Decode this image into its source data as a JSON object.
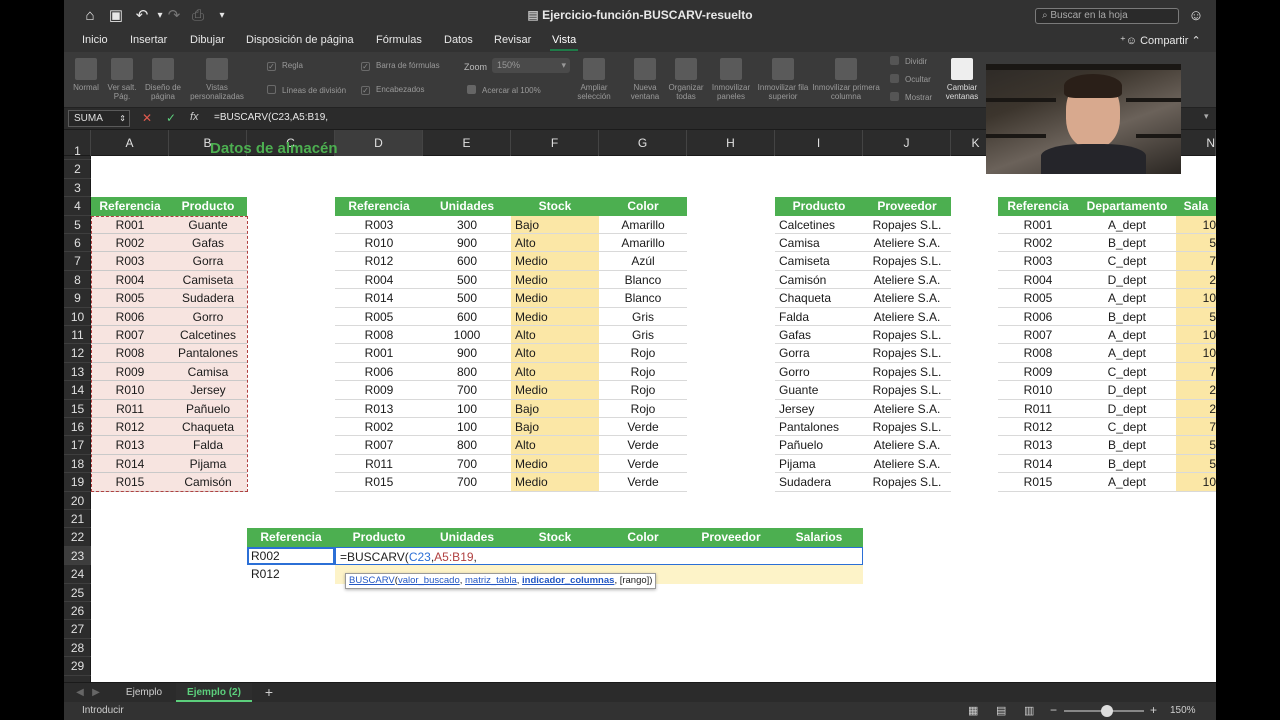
{
  "window": {
    "title": "Ejercicio-función-BUSCARV-resuelto",
    "search_placeholder": "Buscar en la hoja",
    "share_label": "Compartir"
  },
  "ribbon_tabs": [
    "Inicio",
    "Insertar",
    "Dibujar",
    "Disposición de página",
    "Fórmulas",
    "Datos",
    "Revisar",
    "Vista"
  ],
  "active_tab": "Vista",
  "ribbon": {
    "views": [
      "Normal",
      "Ver salt. Pág.",
      "Diseño de página",
      "Vistas personalizadas"
    ],
    "checkboxes": [
      "Regla",
      "Líneas de división",
      "Barra de fórmulas",
      "Encabezados"
    ],
    "zoom_label": "Zoom",
    "zoom_value": "150%",
    "zoom_fit": "Acercar al 100%",
    "zoom_selection": "Ampliar selección",
    "window_buttons": [
      "Nueva ventana",
      "Organizar todas",
      "Inmovilizar paneles",
      "Inmovilizar fila superior",
      "Inmovilizar primera columna"
    ],
    "split_items": [
      "Dividir",
      "Ocultar",
      "Mostrar"
    ],
    "switch_windows": "Cambiar ventanas"
  },
  "formula_bar": {
    "name_box": "SUMA",
    "fx": "fx",
    "formula": "=BUSCARV(C23,A5:B19,"
  },
  "columns": [
    "A",
    "B",
    "C",
    "D",
    "E",
    "F",
    "G",
    "H",
    "I",
    "J",
    "K",
    "N"
  ],
  "rows": [
    "1",
    "2",
    "3",
    "4",
    "5",
    "6",
    "7",
    "8",
    "9",
    "10",
    "11",
    "12",
    "13",
    "14",
    "15",
    "16",
    "17",
    "18",
    "19",
    "20",
    "21",
    "22",
    "23",
    "24",
    "25",
    "26",
    "27",
    "28",
    "29"
  ],
  "partial_title": "Datos de almacén",
  "table1": {
    "headers": [
      "Referencia",
      "Producto"
    ],
    "rows": [
      [
        "R001",
        "Guante"
      ],
      [
        "R002",
        "Gafas"
      ],
      [
        "R003",
        "Gorra"
      ],
      [
        "R004",
        "Camiseta"
      ],
      [
        "R005",
        "Sudadera"
      ],
      [
        "R006",
        "Gorro"
      ],
      [
        "R007",
        "Calcetines"
      ],
      [
        "R008",
        "Pantalones"
      ],
      [
        "R009",
        "Camisa"
      ],
      [
        "R010",
        "Jersey"
      ],
      [
        "R011",
        "Pañuelo"
      ],
      [
        "R012",
        "Chaqueta"
      ],
      [
        "R013",
        "Falda"
      ],
      [
        "R014",
        "Pijama"
      ],
      [
        "R015",
        "Camisón"
      ]
    ]
  },
  "table2": {
    "headers": [
      "Referencia",
      "Unidades",
      "Stock",
      "Color"
    ],
    "rows": [
      [
        "R003",
        "300",
        "Bajo",
        "Amarillo"
      ],
      [
        "R010",
        "900",
        "Alto",
        "Amarillo"
      ],
      [
        "R012",
        "600",
        "Medio",
        "Azúl"
      ],
      [
        "R004",
        "500",
        "Medio",
        "Blanco"
      ],
      [
        "R014",
        "500",
        "Medio",
        "Blanco"
      ],
      [
        "R005",
        "600",
        "Medio",
        "Gris"
      ],
      [
        "R008",
        "1000",
        "Alto",
        "Gris"
      ],
      [
        "R001",
        "900",
        "Alto",
        "Rojo"
      ],
      [
        "R006",
        "800",
        "Alto",
        "Rojo"
      ],
      [
        "R009",
        "700",
        "Medio",
        "Rojo"
      ],
      [
        "R013",
        "100",
        "Bajo",
        "Rojo"
      ],
      [
        "R002",
        "100",
        "Bajo",
        "Verde"
      ],
      [
        "R007",
        "800",
        "Alto",
        "Verde"
      ],
      [
        "R011",
        "700",
        "Medio",
        "Verde"
      ],
      [
        "R015",
        "700",
        "Medio",
        "Verde"
      ]
    ]
  },
  "table3": {
    "headers": [
      "Producto",
      "Proveedor"
    ],
    "rows": [
      [
        "Calcetines",
        "Ropajes S.L."
      ],
      [
        "Camisa",
        "Ateliere S.A."
      ],
      [
        "Camiseta",
        "Ropajes S.L."
      ],
      [
        "Camisón",
        "Ateliere S.A."
      ],
      [
        "Chaqueta",
        "Ateliere S.A."
      ],
      [
        "Falda",
        "Ateliere S.A."
      ],
      [
        "Gafas",
        "Ropajes S.L."
      ],
      [
        "Gorra",
        "Ropajes S.L."
      ],
      [
        "Gorro",
        "Ropajes S.L."
      ],
      [
        "Guante",
        "Ropajes S.L."
      ],
      [
        "Jersey",
        "Ateliere S.A."
      ],
      [
        "Pantalones",
        "Ropajes S.L."
      ],
      [
        "Pañuelo",
        "Ateliere S.A."
      ],
      [
        "Pijama",
        "Ateliere S.A."
      ],
      [
        "Sudadera",
        "Ropajes S.L."
      ]
    ]
  },
  "table4": {
    "headers": [
      "Referencia",
      "Departamento",
      "Sala"
    ],
    "rows": [
      [
        "R001",
        "A_dept",
        "10"
      ],
      [
        "R002",
        "B_dept",
        "5"
      ],
      [
        "R003",
        "C_dept",
        "7"
      ],
      [
        "R004",
        "D_dept",
        "2"
      ],
      [
        "R005",
        "A_dept",
        "10"
      ],
      [
        "R006",
        "B_dept",
        "5"
      ],
      [
        "R007",
        "A_dept",
        "10"
      ],
      [
        "R008",
        "A_dept",
        "10"
      ],
      [
        "R009",
        "C_dept",
        "7"
      ],
      [
        "R010",
        "D_dept",
        "2"
      ],
      [
        "R011",
        "D_dept",
        "2"
      ],
      [
        "R012",
        "C_dept",
        "7"
      ],
      [
        "R013",
        "B_dept",
        "5"
      ],
      [
        "R014",
        "B_dept",
        "5"
      ],
      [
        "R015",
        "A_dept",
        "10"
      ]
    ]
  },
  "summary": {
    "headers": [
      "Referencia",
      "Producto",
      "Unidades",
      "Stock",
      "Color",
      "Proveedor",
      "Salarios"
    ],
    "row1_ref": "R002",
    "row1_formula_prefix": "=BUSCARV(",
    "row1_formula_arg1": "C23",
    "row1_formula_sep": ",",
    "row1_formula_arg2": "A5:B19",
    "row1_formula_end": ",",
    "row2_ref": "R012"
  },
  "tooltip": {
    "fn": "BUSCARV",
    "open": "(",
    "arg1": "valor_buscado",
    "arg2": "matriz_tabla",
    "arg3": "indicador_columnas",
    "arg4": "[rango]",
    "close": ")"
  },
  "sheets": [
    "Ejemplo",
    "Ejemplo (2)"
  ],
  "active_sheet": "Ejemplo (2)",
  "status": {
    "mode": "Introducir",
    "zoom": "150%"
  }
}
